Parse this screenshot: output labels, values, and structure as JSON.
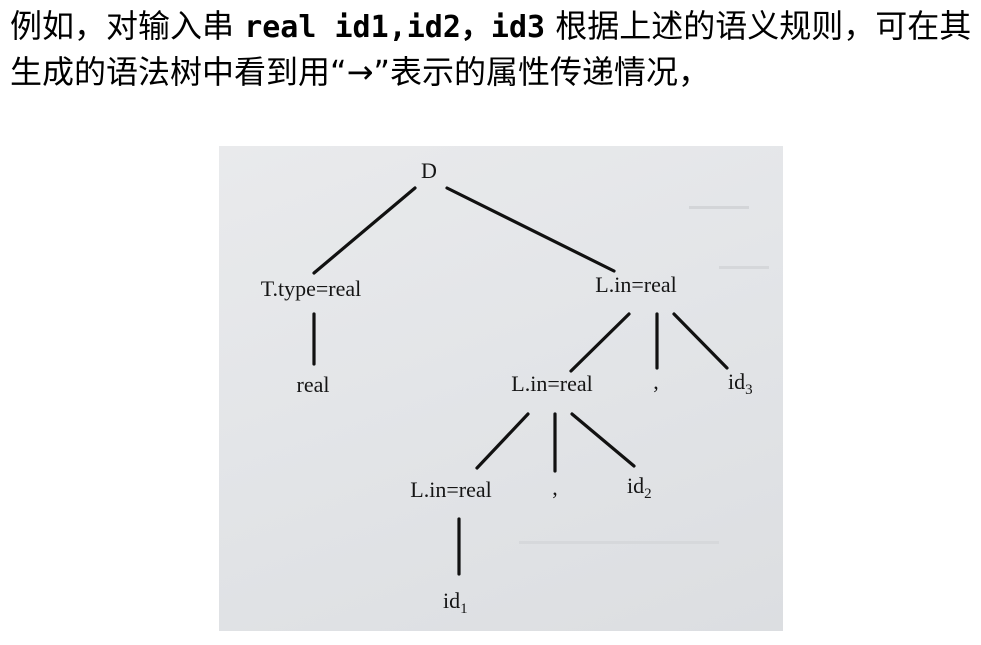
{
  "intro": {
    "part1": "例如，对输入串 ",
    "code": "real id1,id2，id3",
    "part2": " 根据上述的语义规则，可在其生成的语法树中看到用“→”表示的属性传递情况，"
  },
  "tree": {
    "nodes": {
      "root": "D",
      "type_node": "T.type=real",
      "real_leaf": "real",
      "list_top": "L.in=real",
      "list_mid": "L.in=real",
      "comma_top": ",",
      "id3_base": "id",
      "id3_sub": "3",
      "list_low": "L.in=real",
      "comma_mid": ",",
      "id2_base": "id",
      "id2_sub": "2",
      "id1_base": "id",
      "id1_sub": "1"
    }
  }
}
